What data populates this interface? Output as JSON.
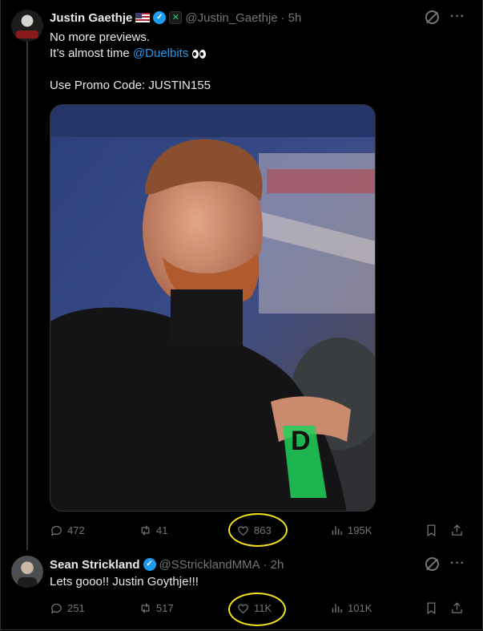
{
  "tweet1": {
    "name": "Justin Gaethje",
    "handle": "@Justin_Gaethje",
    "time": "5h",
    "text_line1": "No more previews.",
    "text_line2_prefix": "It’s almost time",
    "mention": "@Duelbits",
    "text_line3": "Use Promo Code: JUSTIN155",
    "stats": {
      "replies": "472",
      "reposts": "41",
      "likes": "863",
      "views": "195K"
    }
  },
  "tweet2": {
    "name": "Sean Strickland",
    "handle": "@SStricklandMMA",
    "time": "2h",
    "text": "Lets gooo!! Justin Goythje!!!",
    "stats": {
      "replies": "251",
      "reposts": "517",
      "likes": "11K",
      "views": "101K"
    }
  },
  "separator": "·",
  "icons": [
    "flag-icon",
    "verified-icon",
    "affiliate-badge-icon",
    "grok-icon",
    "more-icon",
    "reply-icon",
    "repost-icon",
    "like-icon",
    "views-icon",
    "bookmark-icon",
    "share-icon",
    "eyes-emoji-icon"
  ],
  "colors": {
    "background": "#000000",
    "text": "#e7e9ea",
    "muted": "#71767b",
    "accent": "#1d9bf0",
    "highlight": "#f4e11e"
  }
}
